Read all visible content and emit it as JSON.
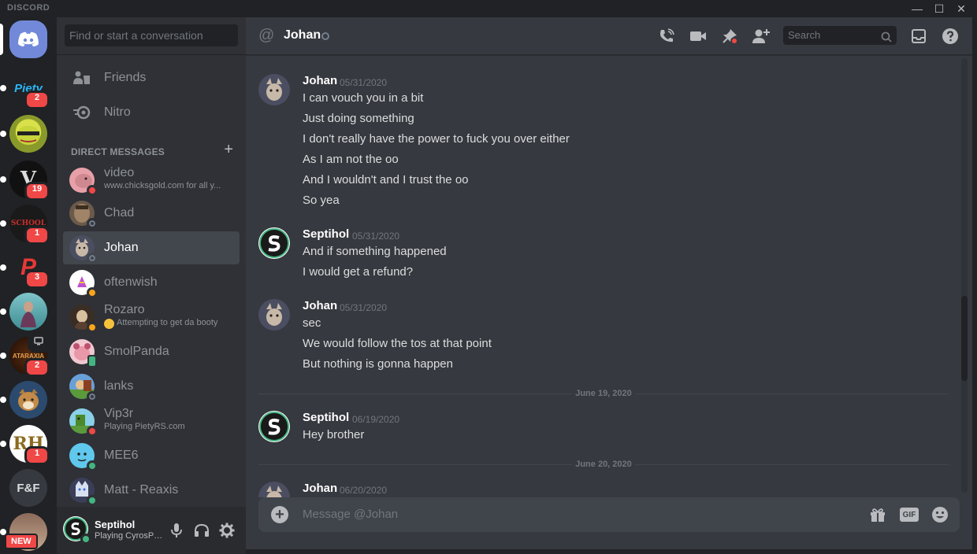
{
  "app": {
    "brand": "DISCORD"
  },
  "window": {
    "minimize": "—",
    "maximize": "☐",
    "close": "✕"
  },
  "guilds": [
    {
      "label": "Home",
      "badge": ""
    },
    {
      "label": "Piety",
      "badge": "2"
    },
    {
      "label": "",
      "badge": ""
    },
    {
      "label": "V",
      "badge": "19"
    },
    {
      "label": "SCHOOL",
      "badge": "1"
    },
    {
      "label": "P",
      "badge": "3"
    },
    {
      "label": "",
      "badge": ""
    },
    {
      "label": "ATARAXIA",
      "badge": "2"
    },
    {
      "label": "",
      "badge": ""
    },
    {
      "label": "RH",
      "badge": "1"
    },
    {
      "label": "F&F",
      "badge": ""
    },
    {
      "label": "",
      "badge": "NEW"
    }
  ],
  "sidebar": {
    "search_placeholder": "Find or start a conversation",
    "friends": "Friends",
    "nitro": "Nitro",
    "dm_header": "Direct Messages",
    "dm_add": "+",
    "dms": [
      {
        "name": "video",
        "sub": "www.chicksgold.com for all y...",
        "status": "dnd"
      },
      {
        "name": "Chad",
        "sub": "",
        "status": "offline"
      },
      {
        "name": "Johan",
        "sub": "",
        "status": "offline",
        "selected": true
      },
      {
        "name": "oftenwish",
        "sub": "",
        "status": "idle"
      },
      {
        "name": "Rozaro",
        "sub": "Attempting to get da booty",
        "status": "idle"
      },
      {
        "name": "SmolPanda",
        "sub": "",
        "status": "mobile"
      },
      {
        "name": "lanks",
        "sub": "",
        "status": "offline"
      },
      {
        "name": "Vip3r",
        "sub": "Playing PietyRS.com",
        "status": "dnd"
      },
      {
        "name": "MEE6",
        "sub": "",
        "status": "online"
      },
      {
        "name": "Matt - Reaxis",
        "sub": "",
        "status": "online"
      }
    ]
  },
  "user": {
    "name": "Septihol",
    "status": "Playing CyrosPS..."
  },
  "chat": {
    "at": "@",
    "channel": "Johan",
    "search_placeholder": "Search",
    "composer_placeholder": "Message @Johan",
    "gif": "GIF",
    "groups": [
      {
        "author": "Johan",
        "ts": "05/31/2020",
        "lines": [
          "I can vouch you in a bit",
          "Just doing something",
          "I don't really have the power to fuck you over either",
          "As I am not the oo",
          "And I wouldn't and I trust the oo",
          "So yea"
        ]
      },
      {
        "author": "Septihol",
        "ts": "05/31/2020",
        "lines": [
          "And if something happened",
          "I would get a refund?"
        ]
      },
      {
        "author": "Johan",
        "ts": "05/31/2020",
        "lines": [
          "sec",
          "We would follow the tos at that point",
          "But nothing is gonna happen"
        ]
      },
      {
        "author": "Septihol",
        "ts": "06/19/2020",
        "lines": [
          "Hey brother"
        ]
      },
      {
        "author": "Johan",
        "ts": "06/20/2020",
        "lines": []
      }
    ],
    "dividers": [
      "June 19, 2020",
      "June 20, 2020"
    ]
  },
  "colors": {
    "accent": "#7289da",
    "online": "#43b581",
    "idle": "#faa61a",
    "dnd": "#f04747",
    "offline": "#747f8d"
  }
}
